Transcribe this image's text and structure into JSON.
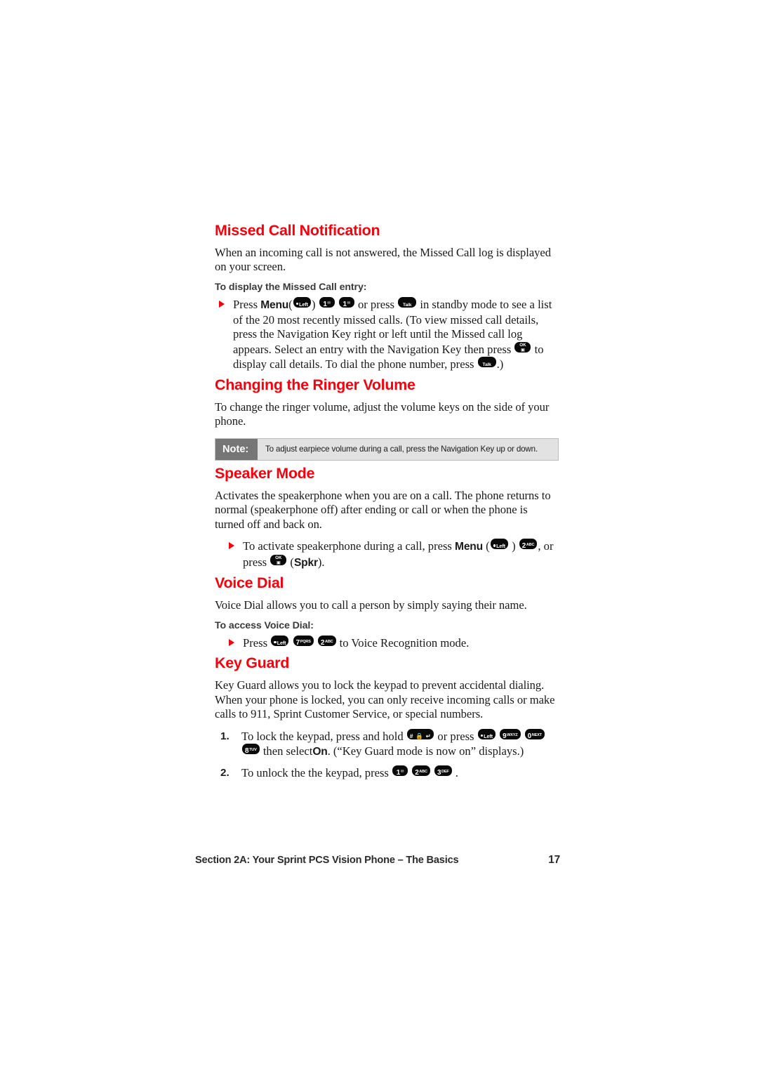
{
  "page": {
    "number": "17",
    "footer_title": "Section 2A: Your Sprint PCS Vision Phone – The Basics"
  },
  "sections": [
    {
      "id": "missed-call-notification",
      "heading": "Missed Call Notification",
      "body": "When an incoming call is not answered, the Missed Call log is displayed on your screen.",
      "subhead": "To display the Missed Call entry:",
      "bullet_parts": {
        "press": "Press",
        "menu": "Menu",
        "open_paren": "(",
        "close_paren": ")",
        "or_press": "or press",
        "tail_1": "in standby mode to see a list of the 20 most recently missed calls. (To view missed call details, press the Navigation Key right or left until the Missed call log appears.  Select an entry with the Navigation Key then press",
        "tail_2": "to display call details.  To dial the phone number, press",
        "tail_3": ".)"
      }
    },
    {
      "id": "changing-the-ringer-volume",
      "heading": "Changing the Ringer Volume",
      "body": "To change the ringer volume, adjust the volume keys on the side of your phone.",
      "note": {
        "label": "Note:",
        "text": "To adjust earpiece volume during a call, press the Navigation Key up or down."
      }
    },
    {
      "id": "speaker-mode",
      "heading": "Speaker Mode",
      "body": "Activates the speakerphone when you are on a call. The phone returns to normal (speakerphone off) after ending or call or when the phone is turned off and back on.",
      "bullet_parts": {
        "lead": "To activate speakerphone during a call, press",
        "menu": "Menu",
        "open_paren": "(",
        "close_paren": ")",
        "comma": ",",
        "or_press": "or press",
        "spkr_open": "(",
        "spkr": "Spkr",
        "spkr_close": ")."
      }
    },
    {
      "id": "voice-dial",
      "heading": "Voice Dial",
      "body": "Voice Dial allows you to call a person by simply saying their name.",
      "subhead": "To access Voice Dial:",
      "bullet_parts": {
        "press": "Press",
        "tail": "to Voice Recognition mode."
      }
    },
    {
      "id": "key-guard",
      "heading": "Key Guard",
      "body": "Key Guard allows you to lock the keypad to prevent accidental dialing. When your phone is locked, you can only receive incoming calls or make calls to 911, Sprint Customer Service, or special numbers.",
      "steps": [
        {
          "num": "1.",
          "part_a": "To lock the keypad, press and hold",
          "part_b": "or press",
          "part_c": "then select",
          "on_word": "On",
          "part_d": ". (“Key Guard mode is now on” displays.)"
        },
        {
          "num": "2.",
          "part_a": "To unlock the the keypad, press",
          "part_b": "."
        }
      ]
    }
  ],
  "keys": {
    "left_soft": {
      "name": "left-softkey",
      "dot": "●",
      "label": "Left"
    },
    "talk": {
      "name": "talk-key",
      "label": "Talk"
    },
    "ok": {
      "name": "ok-key",
      "top": "OK",
      "bottom": "▣"
    },
    "one": {
      "digit": "1",
      "sub": "✉"
    },
    "two": {
      "digit": "2",
      "sub": "ABC"
    },
    "three": {
      "digit": "3",
      "sub": "DEF"
    },
    "seven": {
      "digit": "7",
      "sub": "PQRS"
    },
    "eight": {
      "digit": "8",
      "sub": "TUV"
    },
    "nine": {
      "digit": "9",
      "sub": "WXYZ"
    },
    "zero": {
      "digit": "0",
      "sub": "NEXT"
    },
    "hash": {
      "label": "# 🔒 ↵"
    }
  },
  "colors": {
    "heading_red": "#f8000c",
    "bullet_red": "#f8000c",
    "key_black": "#0a0a0a",
    "note_label_gray": "#767676",
    "note_body_gray": "#e2e2e2"
  }
}
